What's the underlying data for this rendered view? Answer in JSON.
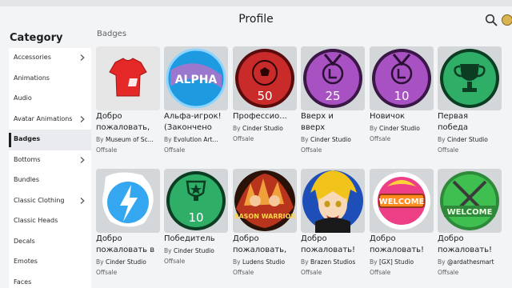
{
  "header": {
    "title": "Profile"
  },
  "sidebar": {
    "title": "Category",
    "items": [
      {
        "label": "Accessories",
        "chevron": true
      },
      {
        "label": "Animations",
        "chevron": false
      },
      {
        "label": "Audio",
        "chevron": false
      },
      {
        "label": "Avatar Animations",
        "chevron": true
      },
      {
        "label": "Badges",
        "chevron": false,
        "active": true
      },
      {
        "label": "Bottoms",
        "chevron": true
      },
      {
        "label": "Bundles",
        "chevron": false
      },
      {
        "label": "Classic Clothing",
        "chevron": true
      },
      {
        "label": "Classic Heads",
        "chevron": false
      },
      {
        "label": "Decals",
        "chevron": false
      },
      {
        "label": "Emotes",
        "chevron": false
      },
      {
        "label": "Faces",
        "chevron": false
      }
    ]
  },
  "section": {
    "label": "Badges"
  },
  "by_label": "By",
  "cards": [
    {
      "name": "Добро\nпожаловать,",
      "creator": "Museum of Sc...",
      "price": "Offsale",
      "icon": "red-shirt-icon"
    },
    {
      "name": "Альфа-игрок!\n(Закончено",
      "creator": "Evolution Art...",
      "price": "Offsale",
      "icon": "alpha-badge-icon",
      "badge_text": "ALPHA"
    },
    {
      "name": "Профессио...",
      "creator": "Cinder Studio",
      "price": "Offsale",
      "icon": "soccer-ball-badge-icon",
      "badge_text": "50"
    },
    {
      "name": "Вверх и\nвверх",
      "creator": "Cinder Studio",
      "price": "Offsale",
      "icon": "medal-badge-icon",
      "badge_text": "25"
    },
    {
      "name": "Новичок",
      "creator": "Cinder Studio",
      "price": "Offsale",
      "icon": "medal-badge-icon",
      "badge_text": "10"
    },
    {
      "name": "Первая\nпобеда",
      "creator": "Cinder Studio",
      "price": "Offsale",
      "icon": "trophy-badge-icon"
    },
    {
      "name": "Добро\nпожаловать в",
      "creator": "Cinder Studio",
      "price": "Offsale",
      "icon": "lightning-ball-badge-icon"
    },
    {
      "name": "Победитель",
      "creator": "Cinder Studio",
      "price": "Offsale",
      "icon": "star-trophy-badge-icon",
      "badge_text": "10"
    },
    {
      "name": "Добро\nпожаловать,",
      "creator": "Ludens Studio",
      "price": "Offsale",
      "icon": "anime-warriors-badge-icon",
      "badge_text": "BASON WARRIOR"
    },
    {
      "name": "Добро\nпожаловать!",
      "creator": "Brazen Studios",
      "price": "Offsale",
      "icon": "anime-character-badge-icon"
    },
    {
      "name": "Добро\nпожаловать!",
      "creator": "[GX] Studio",
      "price": "Offsale",
      "icon": "welcome-badge-icon",
      "badge_text": "WELCOME"
    },
    {
      "name": "Добро\nпожаловать!",
      "creator": "@ardathesmart",
      "price": "Offsale",
      "icon": "welcome-swords-badge-icon",
      "badge_text": "WELCOME"
    }
  ],
  "colors": {
    "background": "#f2f4f5",
    "thumb_bg": "#d4d7da",
    "text": "#1e1e1e",
    "secondary_text": "#606162"
  }
}
